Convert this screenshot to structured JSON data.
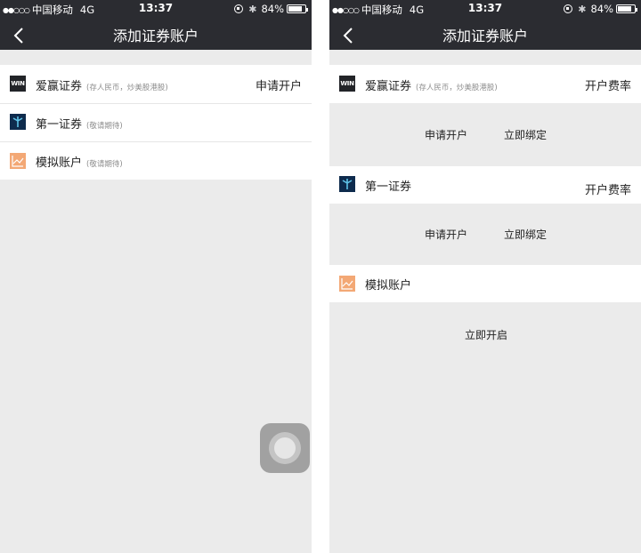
{
  "status_bar": {
    "signal": "●●○○○",
    "carrier": "中国移动",
    "network": "4G",
    "time": "13:37",
    "battery_text": "84%",
    "battery_level": 0.84
  },
  "nav": {
    "title": "添加证券账户",
    "back_icon": "chevron-left-icon"
  },
  "left_screen": {
    "rows": [
      {
        "logo_text": "WIN",
        "name": "爱赢证券",
        "note": "(存人民币，炒美股港股)",
        "action": "申请开户"
      },
      {
        "name": "第一证券",
        "note": "(敬请期待)"
      },
      {
        "name": "模拟账户",
        "note": "(敬请期待)"
      }
    ]
  },
  "right_screen": {
    "sections": [
      {
        "logo_text": "WIN",
        "name": "爱赢证券",
        "note": "(存人民币，炒美股港股)",
        "fee_label": "开户费率",
        "actions": [
          "申请开户",
          "立即绑定"
        ]
      },
      {
        "name": "第一证券",
        "fee_label": "开户费率",
        "actions": [
          "申请开户",
          "立即绑定"
        ]
      },
      {
        "name": "模拟账户",
        "actions": [
          "立即开启"
        ]
      }
    ]
  },
  "colors": {
    "nav_background": "#2b2c31",
    "page_background": "#ebebeb",
    "win_logo": "#222428",
    "first_logo": "#0e2b4d",
    "sim_logo": "#f3a875"
  }
}
